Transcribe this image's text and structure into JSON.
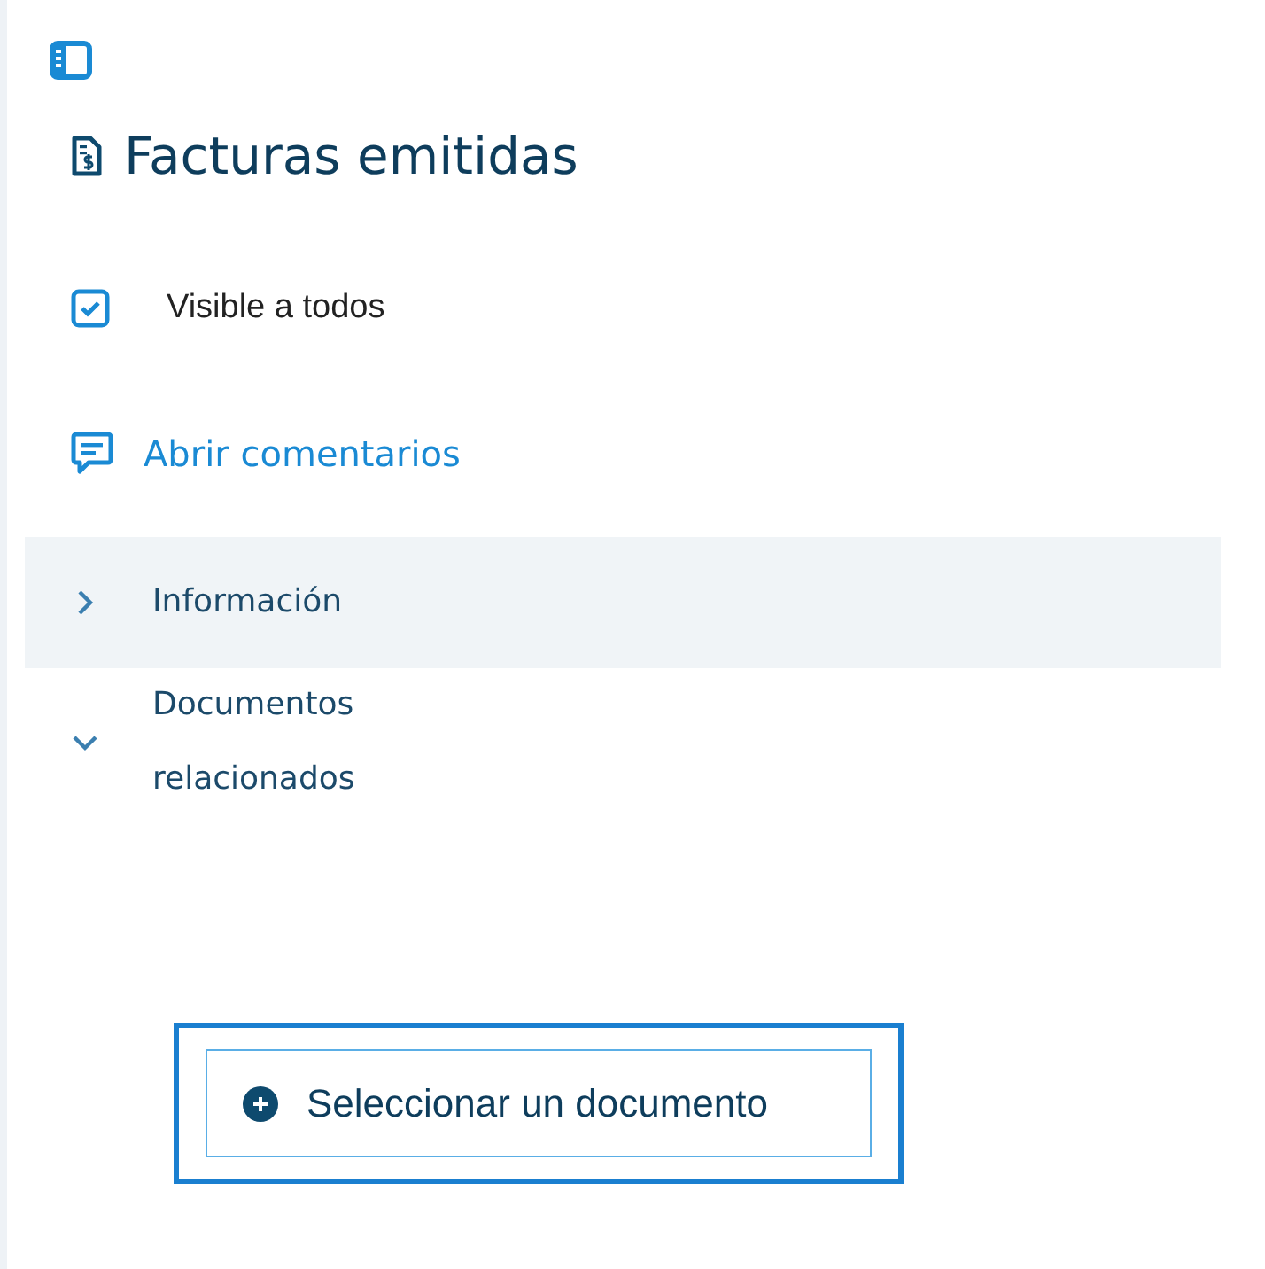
{
  "title": "Facturas emitidas",
  "visibility": {
    "label": "Visible a todos",
    "checked": true
  },
  "comments_link": "Abrir comentarios",
  "sections": [
    {
      "label": "Información",
      "expanded": false,
      "selected": true
    },
    {
      "label": "Documentos relacionados",
      "expanded": true,
      "selected": false
    }
  ],
  "select_button": {
    "label": "Seleccionar un documento",
    "focused": true
  }
}
